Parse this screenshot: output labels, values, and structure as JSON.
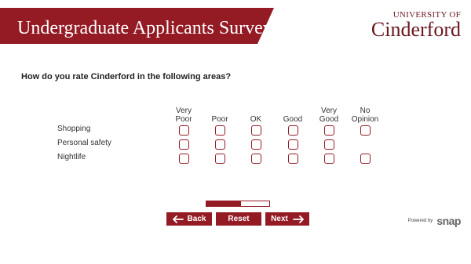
{
  "header": {
    "title": "Undergraduate Applicants Survey",
    "logo_top": "UNIVERSITY OF",
    "logo_name": "Cinderford"
  },
  "question": "How do you rate Cinderford in the following areas?",
  "columns": [
    {
      "line1": "Very",
      "line2": "Poor"
    },
    {
      "line1": "",
      "line2": "Poor"
    },
    {
      "line1": "",
      "line2": "OK"
    },
    {
      "line1": "",
      "line2": "Good"
    },
    {
      "line1": "Very",
      "line2": "Good"
    },
    {
      "line1": "No",
      "line2": "Opinion"
    }
  ],
  "rows": [
    {
      "label": "Shopping",
      "options": [
        true,
        true,
        true,
        true,
        true,
        true
      ]
    },
    {
      "label": "Personal safety",
      "options": [
        true,
        true,
        true,
        true,
        true,
        false
      ]
    },
    {
      "label": "Nightlife",
      "options": [
        true,
        true,
        true,
        true,
        true,
        true
      ]
    }
  ],
  "progress": {
    "fraction": 0.55
  },
  "nav": {
    "back_label": "Back",
    "reset_label": "Reset",
    "next_label": "Next"
  },
  "footer": {
    "powered_by": "Powered by",
    "snap_logo": "snap"
  },
  "colors": {
    "accent": "#941a24"
  }
}
